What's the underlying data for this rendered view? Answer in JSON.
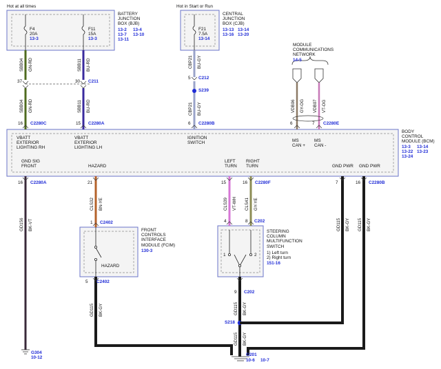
{
  "header": {
    "hot_at_all_times": "Hot at all times",
    "hot_in_start_run": "Hot in Start or Run"
  },
  "bjb": {
    "name": "BATTERY\nJUNCTION\nBOX (BJB)",
    "refs": [
      "13-2",
      "13-4",
      "13-7",
      "13-10",
      "13-11"
    ],
    "fuse_f4": {
      "id": "F4",
      "rating": "20A",
      "ref": "13-3"
    },
    "fuse_f11": {
      "id": "F11",
      "rating": "15A",
      "ref": "13-3"
    }
  },
  "cjb": {
    "name": "CENTRAL\nJUNCTION\nBOX (CJB)",
    "refs": [
      "13-13",
      "13-14",
      "13-16",
      "13-20"
    ],
    "fuse_f21": {
      "id": "F21",
      "rating": "7.5A",
      "ref": "13-14"
    }
  },
  "network": {
    "name": "MODULE\nCOMMUNICATIONS\nNETWORK",
    "ref": "14-5"
  },
  "bcm": {
    "name": "BODY\nCONTROL\nMODULE (BCM)",
    "refs": [
      "13-3",
      "13-14",
      "13-22",
      "13-23",
      "13-24"
    ],
    "pins_top": [
      {
        "label": "VBATT\nEXTERIOR\nLIGHTING RH",
        "pin": "16",
        "connector": "C2280C"
      },
      {
        "label": "VBATT\nEXTERIOR\nLIGHTING LH",
        "pin": "15",
        "connector": "C2280A"
      },
      {
        "label": "IGNITION\nSWITCH",
        "pin": "6",
        "connector": "C2280B"
      },
      {
        "label": "MS\nCAN +",
        "pin": "6",
        "connector": ""
      },
      {
        "label": "MS\nCAN -",
        "pin": "7",
        "connector": "C2280E"
      }
    ],
    "pins_bottom": [
      {
        "label": "GND SIG\nFRONT",
        "pin": "16",
        "connector": "C2280A"
      },
      {
        "label": "HAZARD",
        "pin": "21",
        "connector": ""
      },
      {
        "label": "LEFT\nTURN",
        "pin": "15",
        "connector": ""
      },
      {
        "label": "RIGHT\nTURN",
        "pin": "16",
        "connector": "C2280F"
      },
      {
        "label": "GND PWR",
        "pin": "7",
        "connector": ""
      },
      {
        "label": "GND PWR",
        "pin": "16",
        "connector": "C2280B"
      }
    ]
  },
  "fcim": {
    "name": "FRONT\nCONTROLS\nINTERFACE\nMODULE (FCIM)",
    "ref": "130-3",
    "switch_label": "HAZARD",
    "in_pin": "1",
    "in_conn": "C2402",
    "out_pin": "5",
    "out_conn": "C2402"
  },
  "scm": {
    "name": "STEERING\nCOLUMN\nMULTIFUNCTION\nSWITCH",
    "notes": "1) Left turn\n2) Right turn",
    "ref": "151-16",
    "pin_left": "4",
    "pin_right": "8",
    "in_conn": "C202",
    "pos1": "1",
    "pos2": "2",
    "out_pin": "9",
    "out_conn": "C202"
  },
  "wires": {
    "sbb04": {
      "circuit": "SBB04",
      "color": "GN-RD"
    },
    "sbb11": {
      "circuit": "SBB11",
      "color": "BU-RD"
    },
    "cbp21": {
      "circuit": "CBP21",
      "color": "BU-GY"
    },
    "vdb06": {
      "circuit": "VDB06",
      "color": "GY-OG"
    },
    "vdb07": {
      "circuit": "VDB07",
      "color": "VT-OG"
    },
    "gd156": {
      "circuit": "GD156",
      "color": "BK-VT"
    },
    "cls32": {
      "circuit": "CLS32",
      "color": "BN-YE"
    },
    "cls39": {
      "circuit": "CLS39",
      "color": "VT-WH"
    },
    "cls41": {
      "circuit": "CLS41",
      "color": "GY-YE"
    },
    "gd115": {
      "circuit": "GD115",
      "color": "BK-GY"
    }
  },
  "connectors": {
    "c211": {
      "name": "C211",
      "pin_a": "37",
      "pin_b": "30"
    },
    "c212": {
      "name": "C212",
      "pin": "5"
    },
    "s239": "S239",
    "s218": "S218",
    "g304": {
      "name": "G304",
      "ref": "10-12"
    },
    "g201": {
      "name": "G201",
      "refs": [
        "10-6",
        "10-7"
      ]
    }
  },
  "colors": {
    "gn_rd": "#4f6b1f",
    "bu_rd": "#3a2a9e",
    "bu_gy": "#9aa3c9",
    "bk_vt": "#3a2a3a",
    "bn_ye": "#b4622a",
    "vt_wh": "#d777d6",
    "gy_ye": "#8c8c55",
    "gy_og": "#8c7a66",
    "vt_og": "#c779b8",
    "bk_gy": "#1a1a1a",
    "box_border": "#6a73c9",
    "box_fill": "#f4f4f4",
    "ref_blue": "#1f2bd6"
  }
}
